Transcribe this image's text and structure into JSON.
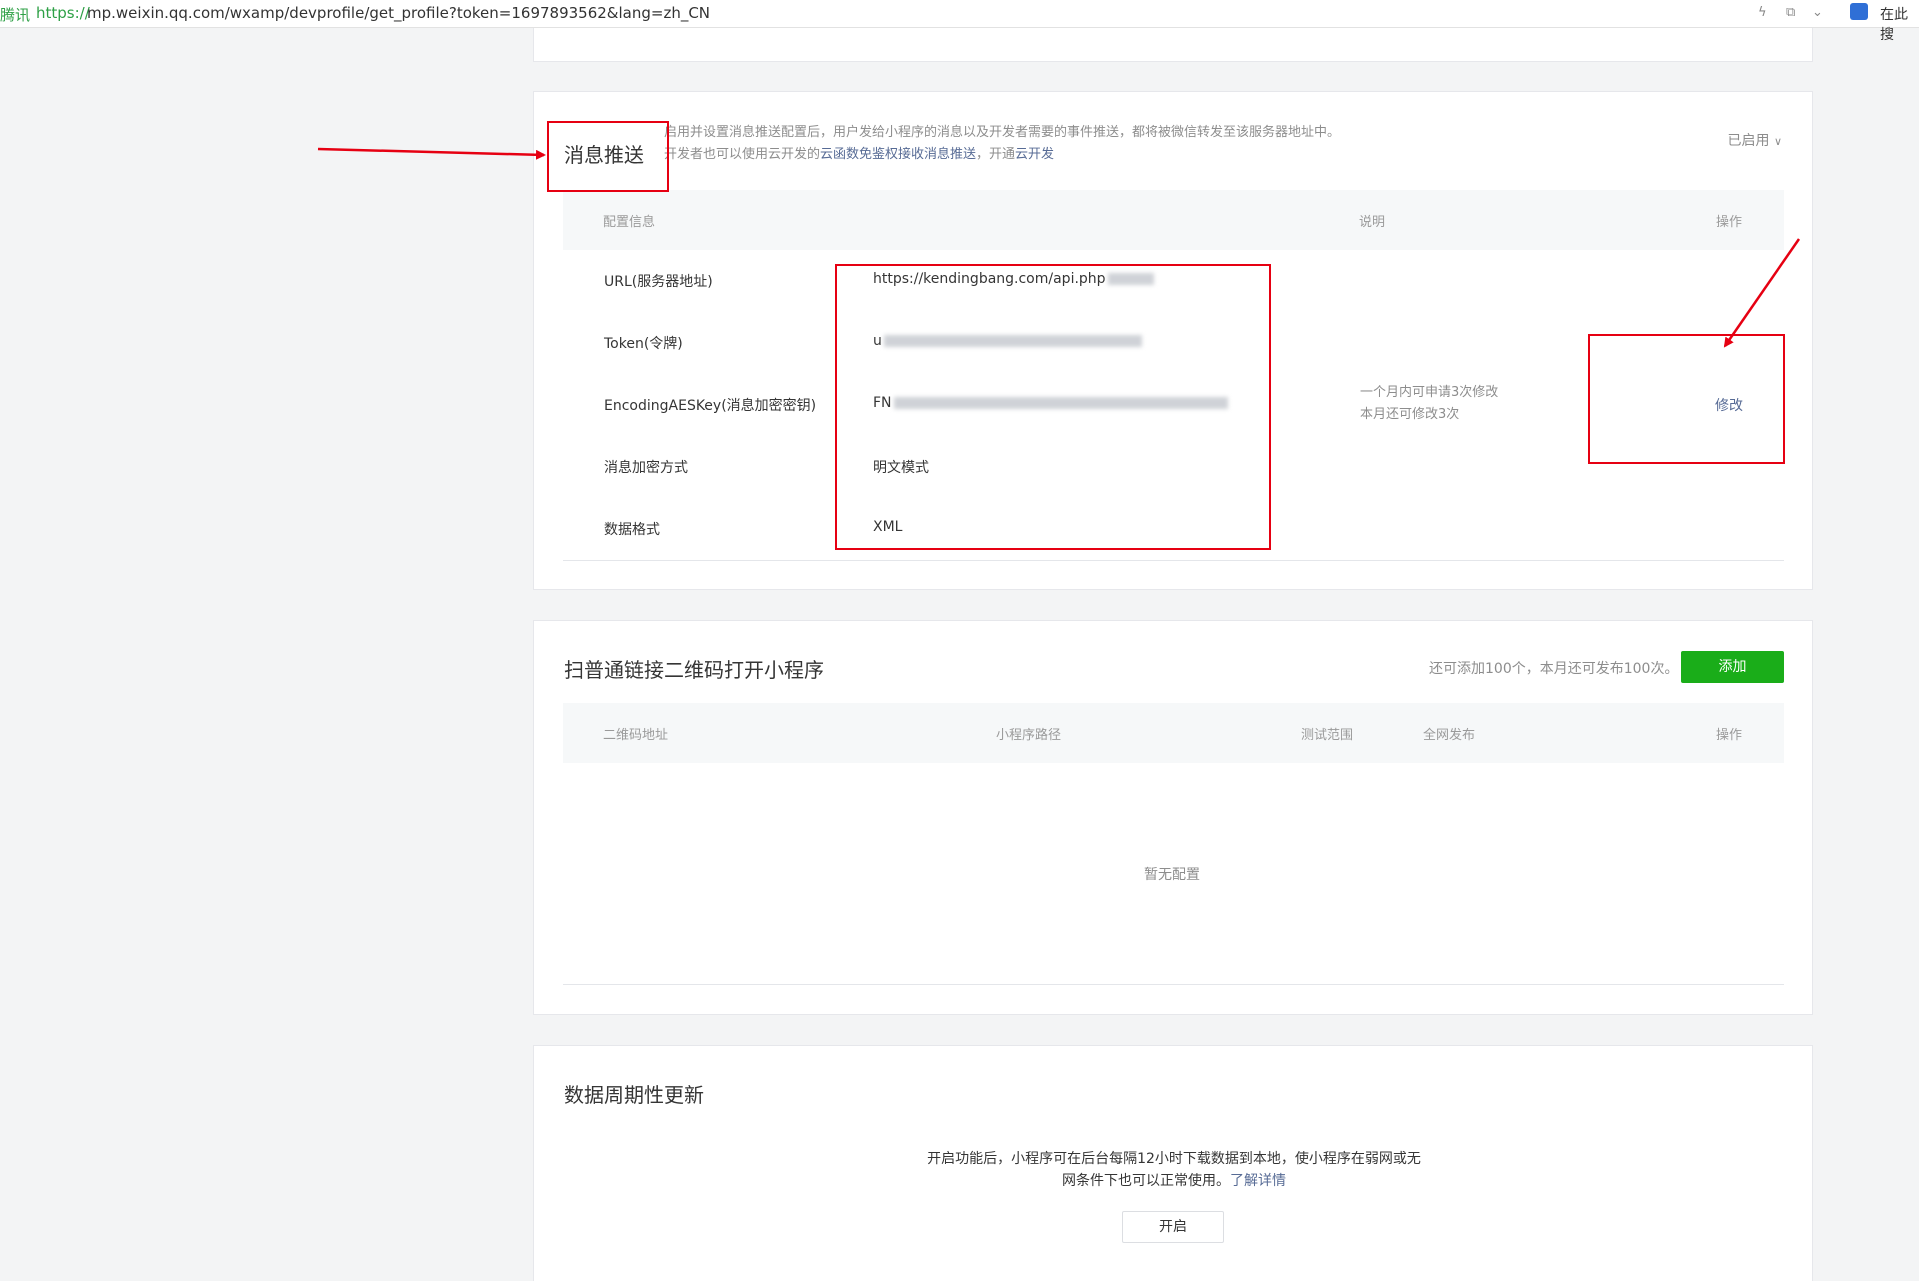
{
  "address_bar": {
    "site_label": "腾讯",
    "url_protocol": "https://",
    "url_rest": "mp.weixin.qq.com/wxamp/devprofile/get_profile?token=1697893562&lang=zh_CN",
    "extension_text": "在此搜"
  },
  "message_push": {
    "title": "消息推送",
    "desc_line1": "启用并设置消息推送配置后，用户发给小程序的消息以及开发者需要的事件推送，都将被微信转发至该服务器地址中。",
    "desc_line2_prefix": "开发者也可以使用云开发的",
    "desc_link1": "云函数免鉴权接收消息推送",
    "desc_line2_sep": "，开通",
    "desc_link2": "云开发",
    "status": "已启用",
    "columns": {
      "config": "配置信息",
      "desc": "说明",
      "action": "操作"
    },
    "rows": [
      {
        "label": "URL(服务器地址)",
        "value": "https://kendingbang.com/api.php"
      },
      {
        "label": "Token(令牌)",
        "value": "u"
      },
      {
        "label": "EncodingAESKey(消息加密密钥)",
        "value": "FN"
      },
      {
        "label": "消息加密方式",
        "value": "明文模式"
      },
      {
        "label": "数据格式",
        "value": "XML"
      }
    ],
    "note_line1": "一个月内可申请3次修改",
    "note_line2": "本月还可修改3次",
    "modify_link": "修改"
  },
  "qrcode": {
    "title": "扫普通链接二维码打开小程序",
    "quota_text": "还可添加100个，本月还可发布100次。",
    "add_button": "添加",
    "columns": {
      "addr": "二维码地址",
      "path": "小程序路径",
      "test": "测试范围",
      "publish": "全网发布",
      "action": "操作"
    },
    "empty_text": "暂无配置"
  },
  "periodic": {
    "title": "数据周期性更新",
    "desc_line1": "开启功能后，小程序可在后台每隔12小时下载数据到本地，使小程序在弱网或无",
    "desc_line2_prefix": "网条件下也可以正常使用。",
    "desc_link": "了解详情",
    "enable_button": "开启"
  },
  "colors": {
    "annotation_red": "#e60012",
    "accent_green": "#1aad19",
    "link_blue": "#576b95"
  }
}
